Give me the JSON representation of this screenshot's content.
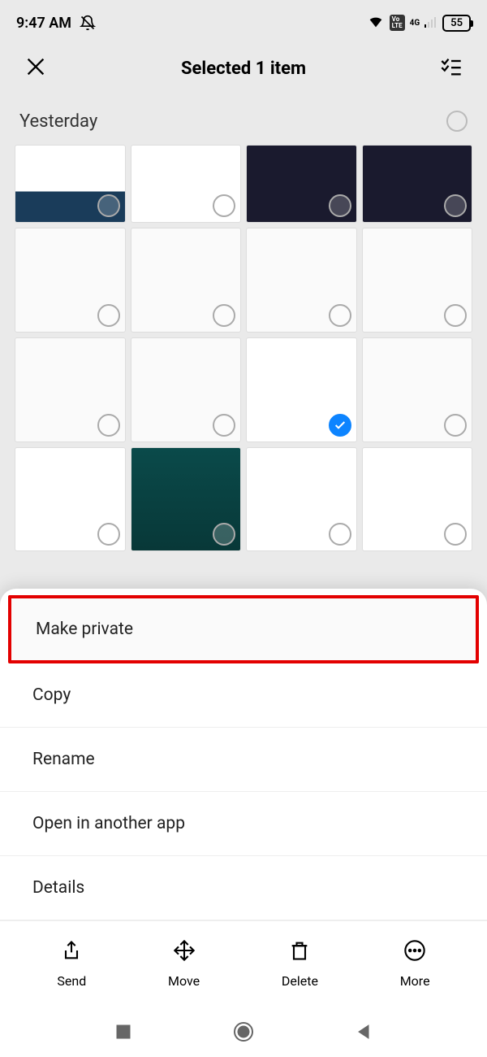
{
  "status": {
    "time": "9:47 AM",
    "network": "4G",
    "battery": "55",
    "volte": "Vo\nLTE"
  },
  "header": {
    "title": "Selected 1 item"
  },
  "section": {
    "label": "Yesterday"
  },
  "menu": {
    "items": [
      {
        "label": "Make private",
        "highlight": true
      },
      {
        "label": "Copy"
      },
      {
        "label": "Rename"
      },
      {
        "label": "Open in another app"
      },
      {
        "label": "Details"
      }
    ]
  },
  "actions": [
    {
      "label": "Send"
    },
    {
      "label": "Move"
    },
    {
      "label": "Delete"
    },
    {
      "label": "More"
    }
  ],
  "thumbs": [
    {
      "c": "t1"
    },
    {
      "c": "t2"
    },
    {
      "c": "t3"
    },
    {
      "c": "t4"
    },
    {
      "c": "t5"
    },
    {
      "c": "t6"
    },
    {
      "c": "t7"
    },
    {
      "c": "t8"
    },
    {
      "c": "t9"
    },
    {
      "c": "t10"
    },
    {
      "c": "t11",
      "checked": true
    },
    {
      "c": "t12"
    },
    {
      "c": "t13"
    },
    {
      "c": "t14"
    },
    {
      "c": "t15"
    },
    {
      "c": "t16"
    }
  ]
}
